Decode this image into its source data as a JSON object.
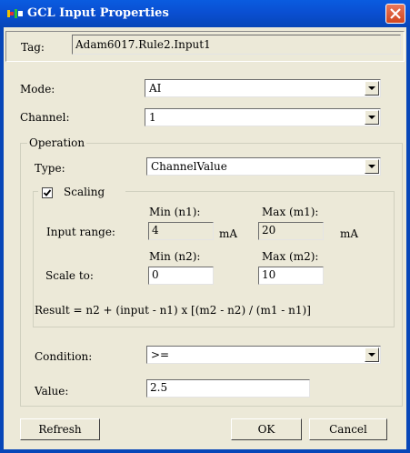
{
  "window": {
    "title": "GCL Input Properties",
    "close_icon": "close-icon",
    "app_icon": "gcl-app-icon"
  },
  "tag": {
    "label": "Tag:",
    "value": "Adam6017.Rule2.Input1"
  },
  "mode": {
    "label": "Mode:",
    "value": "AI"
  },
  "channel": {
    "label": "Channel:",
    "value": "1"
  },
  "operation": {
    "legend": "Operation",
    "type": {
      "label": "Type:",
      "value": "ChannelValue"
    },
    "scaling": {
      "legend": "Scaling",
      "checked": true,
      "min_n1_label": "Min (n1):",
      "max_m1_label": "Max (m1):",
      "input_range_label": "Input range:",
      "min_n1_value": "4",
      "max_m1_value": "20",
      "unit1": "mA",
      "unit2": "mA",
      "min_n2_label": "Min (n2):",
      "max_m2_label": "Max (m2):",
      "scale_to_label": "Scale to:",
      "min_n2_value": "0",
      "max_m2_value": "10",
      "formula": "Result = n2 + (input - n1) x [(m2 - n2) / (m1 - n1)]"
    },
    "condition": {
      "label": "Condition:",
      "value": ">="
    },
    "value": {
      "label": "Value:",
      "value": "2.5"
    }
  },
  "buttons": {
    "refresh": "Refresh",
    "ok": "OK",
    "cancel": "Cancel"
  }
}
